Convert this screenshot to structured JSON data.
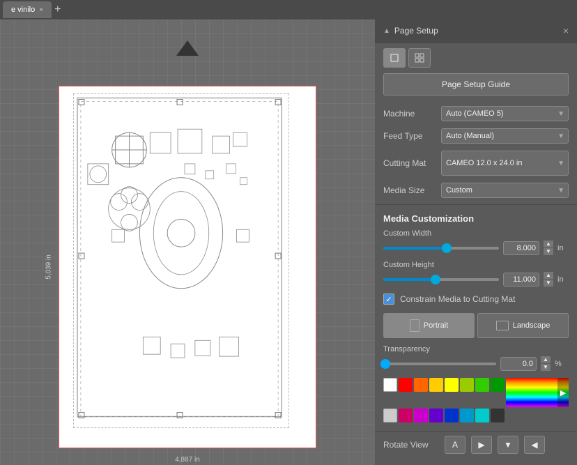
{
  "tab": {
    "name": "e vinilo",
    "close_icon": "×",
    "add_icon": "+"
  },
  "panel": {
    "title": "Page Setup",
    "collapse_icon": "▲",
    "close_icon": "×",
    "guide_button": "Page Setup Guide",
    "view_toggle": [
      {
        "icon": "▭",
        "active": true
      },
      {
        "icon": "⊞",
        "active": false
      }
    ],
    "machine": {
      "label": "Machine",
      "value": "Auto (CAMEO 5)"
    },
    "feed_type": {
      "label": "Feed Type",
      "value": "Auto (Manual)"
    },
    "cutting_mat": {
      "label": "Cutting Mat",
      "value_line1": "CAMEO",
      "value_line2": "12.0 x 24.0 in"
    },
    "media_size": {
      "label": "Media Size",
      "value": "Custom"
    },
    "section_title": "Media Customization",
    "custom_width": {
      "label": "Custom Width",
      "value": "8.000",
      "unit": "in",
      "slider_pct": 55
    },
    "custom_height": {
      "label": "Custom Height",
      "value": "11.000",
      "unit": "in",
      "slider_pct": 45
    },
    "constrain_checkbox": {
      "label": "Constrain Media to Cutting Mat",
      "checked": true
    },
    "orientation": {
      "portrait": "Portrait",
      "landscape": "Landscape"
    },
    "transparency": {
      "label": "Transparency",
      "value": "0.0",
      "unit": "%",
      "slider_pct": 2
    },
    "rotate_view": {
      "label": "Rotate View",
      "buttons": [
        "A",
        "▶",
        "▼",
        "◀"
      ]
    },
    "colors": {
      "row1": [
        "#ffffff",
        "#ff0000",
        "#ff6600",
        "#ffcc00",
        "#ffff00",
        "#99cc00",
        "#33cc00",
        "#009900"
      ],
      "row2": [
        "#cccccc",
        "#cc0066",
        "#cc00cc",
        "#6600cc",
        "#0033cc",
        "#0099cc",
        "#00cccc",
        "#333333"
      ]
    }
  },
  "canvas": {
    "width_label": "4,887 in",
    "height_label": "5,039 in"
  }
}
